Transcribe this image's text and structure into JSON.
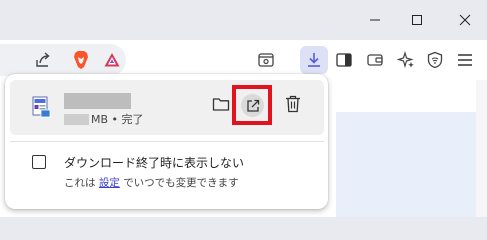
{
  "window": {
    "controls": [
      "minimize-icon",
      "maximize-icon",
      "close-icon"
    ]
  },
  "toolbar": {
    "icons": [
      "share-icon",
      "brave-shields-icon",
      "brave-rewards-icon",
      "reader-mode-icon",
      "downloads-icon",
      "sidebar-icon",
      "wallet-icon",
      "leo-ai-icon",
      "vpn-icon",
      "menu-icon"
    ],
    "accent": "#5b5bd6"
  },
  "download_panel": {
    "item": {
      "file_icon": "file-icon",
      "status": "MB • 完了",
      "actions": [
        "folder-icon",
        "open-external-icon",
        "trash-icon"
      ]
    },
    "checkbox_label": "ダウンロード終了時に表示しない",
    "hint": {
      "prefix": "これは",
      "link": "設定",
      "suffix": "でいつでも変更できます"
    },
    "highlight_color": "#e0141e"
  }
}
